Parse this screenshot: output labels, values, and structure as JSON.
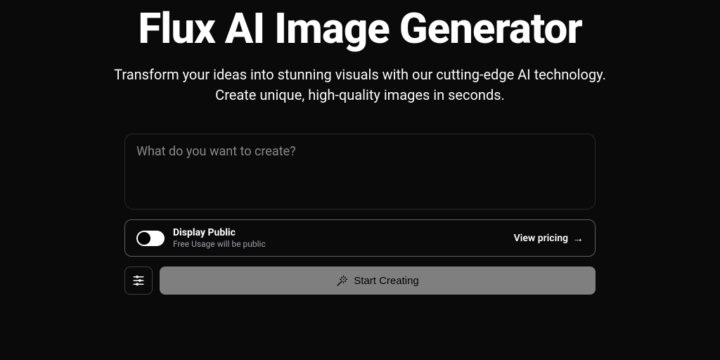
{
  "hero": {
    "title": "Flux AI Image Generator",
    "subtitle": "Transform your ideas into stunning visuals with our cutting-edge AI technology. Create unique, high-quality images in seconds."
  },
  "prompt": {
    "placeholder": "What do you want to create?",
    "value": ""
  },
  "publicToggle": {
    "enabled": true,
    "title": "Display Public",
    "subtitle": "Free Usage will be public"
  },
  "pricing": {
    "label": "View pricing"
  },
  "actions": {
    "startLabel": "Start Creating"
  }
}
